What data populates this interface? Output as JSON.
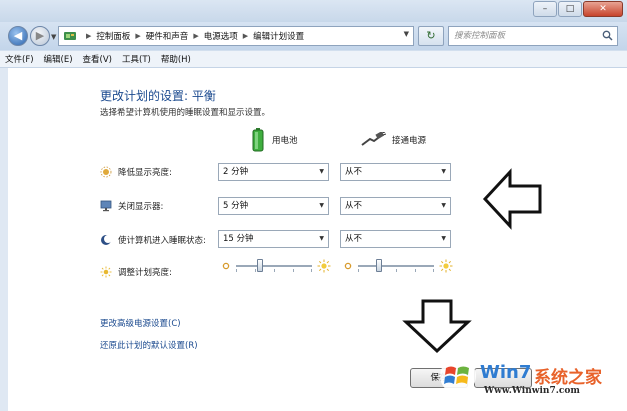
{
  "window": {
    "minimize": "–",
    "maximize": "□",
    "close": "✕"
  },
  "navbar": {
    "breadcrumbs": [
      "控制面板",
      "硬件和声音",
      "电源选项",
      "编辑计划设置"
    ],
    "search_placeholder": "搜索控制面板"
  },
  "menu": [
    "文件(F)",
    "编辑(E)",
    "查看(V)",
    "工具(T)",
    "帮助(H)"
  ],
  "main": {
    "title": "更改计划的设置: 平衡",
    "subtitle": "选择希望计算机使用的睡眠设置和显示设置。",
    "columns": {
      "battery": "用电池",
      "plugged": "接通电源"
    },
    "rows": [
      {
        "label": "降低显示亮度:",
        "icon": "dim-display-icon",
        "battery": "2 分钟",
        "plugged": "从不"
      },
      {
        "label": "关闭显示器:",
        "icon": "monitor-icon",
        "battery": "5 分钟",
        "plugged": "从不"
      },
      {
        "label": "使计算机进入睡眠状态:",
        "icon": "sleep-moon-icon",
        "battery": "15 分钟",
        "plugged": "从不"
      }
    ],
    "brightness_label": "调整计划亮度:",
    "brightness_levels": {
      "battery": 0.3,
      "plugged": 0.25
    },
    "links": {
      "advanced": "更改高级电源设置(C)",
      "restore": "还原此计划的默认设置(R)"
    },
    "save_label": "保存"
  },
  "watermark": {
    "brand": "Win7",
    "title": "系统之家",
    "url": "Www.Winwin7.com"
  },
  "colors": {
    "link": "#1b4a8f",
    "frame": "#c8d8ea",
    "watermark_blue": "#2f7cd1",
    "watermark_orange": "#e8622a"
  }
}
